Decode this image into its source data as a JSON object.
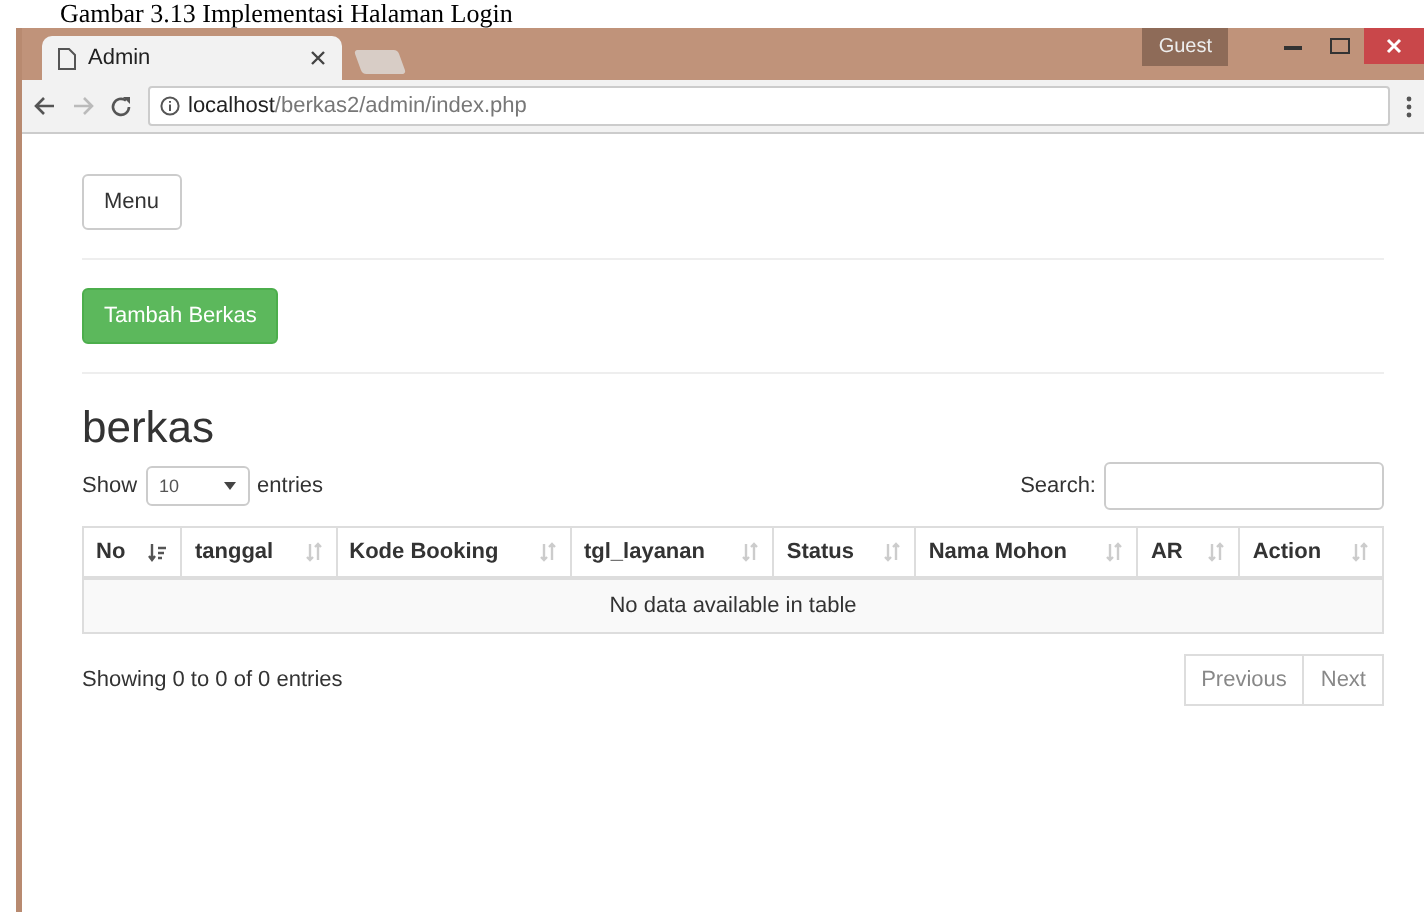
{
  "caption": "Gambar 3.13 Implementasi Halaman Login",
  "browser": {
    "tab_title": "Admin",
    "guest_label": "Guest",
    "url_host": "localhost",
    "url_path": "/berkas2/admin/index.php"
  },
  "menu_button": "Menu",
  "add_button": "Tambah Berkas",
  "heading": "berkas",
  "length": {
    "show": "Show",
    "value": "10",
    "entries": "entries"
  },
  "search": {
    "label": "Search:"
  },
  "table": {
    "columns": [
      {
        "label": "No",
        "sorted": true
      },
      {
        "label": "tanggal",
        "sorted": false
      },
      {
        "label": "Kode Booking",
        "sorted": false
      },
      {
        "label": "tgl_layanan",
        "sorted": false
      },
      {
        "label": "Status",
        "sorted": false
      },
      {
        "label": "Nama Mohon",
        "sorted": false
      },
      {
        "label": "AR",
        "sorted": false
      },
      {
        "label": "Action",
        "sorted": false
      }
    ],
    "empty_message": "No data available in table"
  },
  "info": "Showing 0 to 0 of 0 entries",
  "pagination": [
    {
      "label": "Previous",
      "disabled": true
    },
    {
      "label": "Next",
      "disabled": true
    }
  ]
}
